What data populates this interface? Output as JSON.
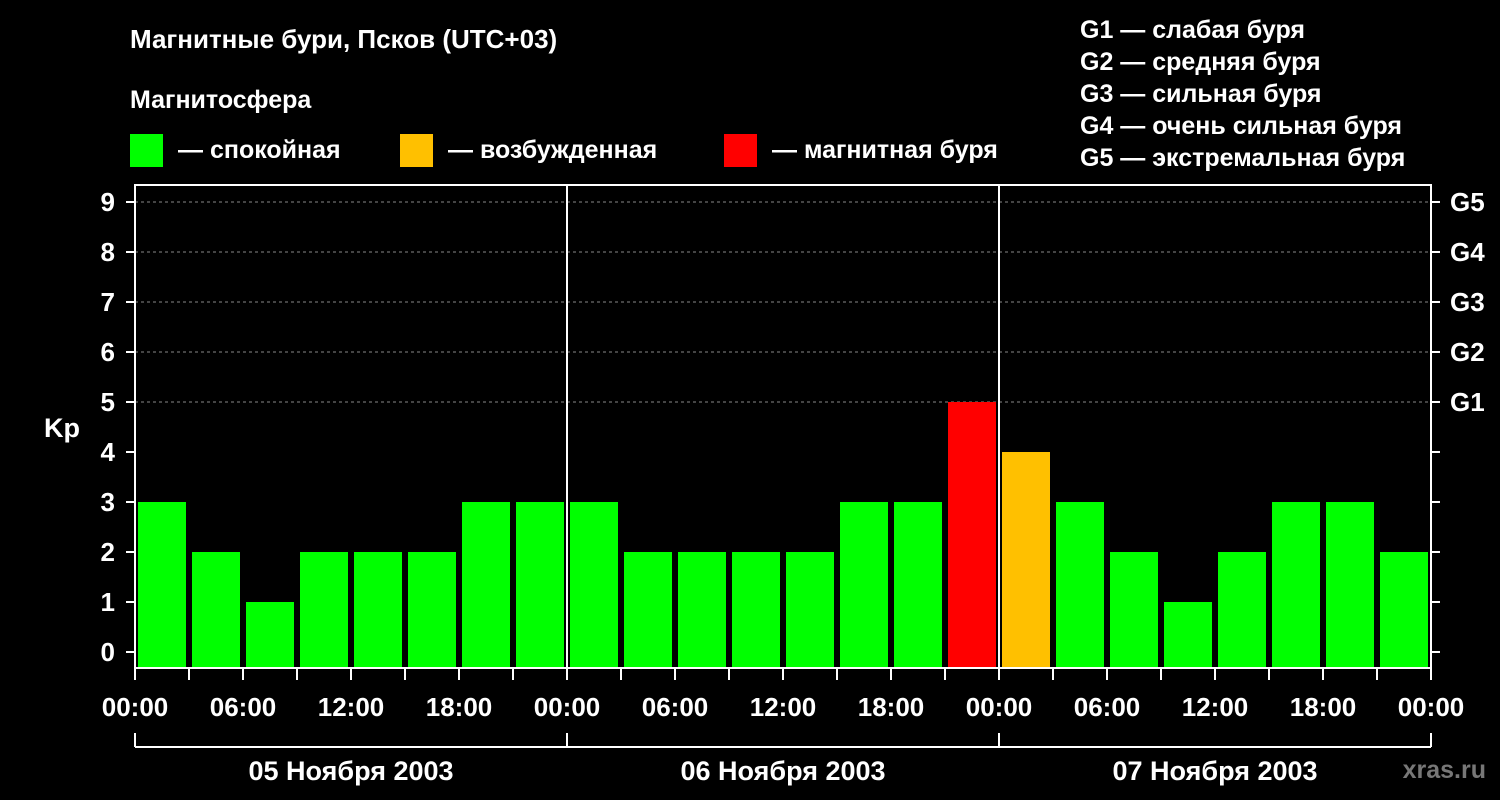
{
  "title": "Магнитные бури, Псков (UTC+03)",
  "subtitle": "Магнитосфера",
  "legend": [
    {
      "label": "— спокойная",
      "color": "#00ff00"
    },
    {
      "label": "— возбужденная",
      "color": "#ffc000"
    },
    {
      "label": "— магнитная буря",
      "color": "#ff0000"
    }
  ],
  "g_scale": [
    "G1 — слабая буря",
    "G2 — средняя буря",
    "G3 — сильная буря",
    "G4 — очень сильная буря",
    "G5 — экстремальная буря"
  ],
  "watermark": "xras.ru",
  "chart_data": {
    "type": "bar",
    "ylabel": "Kp",
    "ylim": [
      0,
      9
    ],
    "yticks": [
      "0",
      "1",
      "2",
      "3",
      "4",
      "5",
      "6",
      "7",
      "8",
      "9"
    ],
    "right_ticks": [
      {
        "kp": 5,
        "label": "G1"
      },
      {
        "kp": 6,
        "label": "G2"
      },
      {
        "kp": 7,
        "label": "G3"
      },
      {
        "kp": 8,
        "label": "G4"
      },
      {
        "kp": 9,
        "label": "G5"
      }
    ],
    "grid": true,
    "xticks": [
      "00:00",
      "06:00",
      "12:00",
      "18:00",
      "00:00",
      "06:00",
      "12:00",
      "18:00",
      "00:00",
      "06:00",
      "12:00",
      "18:00",
      "00:00"
    ],
    "days": [
      "05 Ноября 2003",
      "06 Ноября 2003",
      "07 Ноября 2003"
    ],
    "interval_hours": 3,
    "values": [
      3,
      2,
      1,
      2,
      2,
      2,
      3,
      3,
      3,
      2,
      2,
      2,
      2,
      3,
      3,
      5,
      4,
      3,
      2,
      1,
      2,
      3,
      3,
      2
    ],
    "colors": {
      "quiet": "#00ff00",
      "active": "#ffc000",
      "storm": "#ff0000"
    }
  }
}
